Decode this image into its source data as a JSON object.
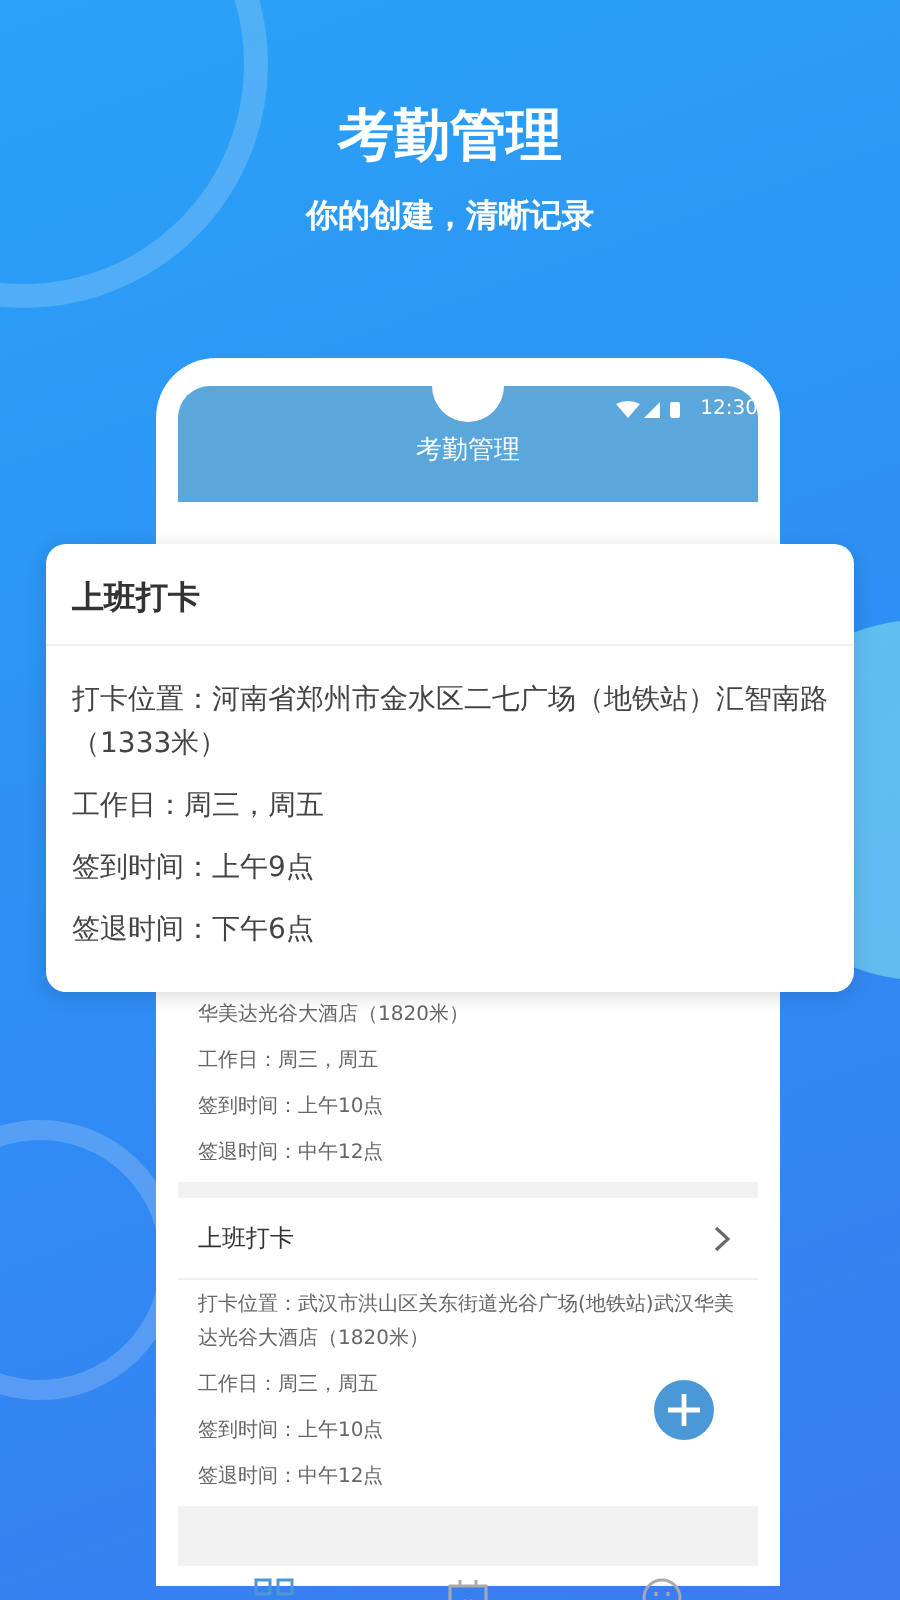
{
  "hero": {
    "title": "考勤管理",
    "subtitle": "你的创建，清晰记录"
  },
  "phone": {
    "status_time": "12:30",
    "app_title": "考勤管理",
    "partial_card": {
      "lines": [
        "华美达光谷大酒店（1820米）",
        "工作日：周三，周五",
        "签到时间：上午10点",
        "签退时间：中午12点"
      ]
    },
    "card": {
      "title": "上班打卡",
      "lines": [
        "打卡位置：武汉市洪山区关东街道光谷广场(地铁站)武汉华美达光谷大酒店（1820米）",
        "工作日：周三，周五",
        "签到时间：上午10点",
        "签退时间：中午12点"
      ]
    },
    "tabs": [
      {
        "kind": "grid",
        "selected": true
      },
      {
        "kind": "calendar",
        "selected": false
      },
      {
        "kind": "face",
        "selected": false
      }
    ]
  },
  "popup_card": {
    "title": "上班打卡",
    "lines": [
      "打卡位置：河南省郑州市金水区二七广场（地铁站）汇智南路（1333米）",
      "工作日：周三，周五",
      "签到时间：上午9点",
      "签退时间：下午6点"
    ]
  }
}
